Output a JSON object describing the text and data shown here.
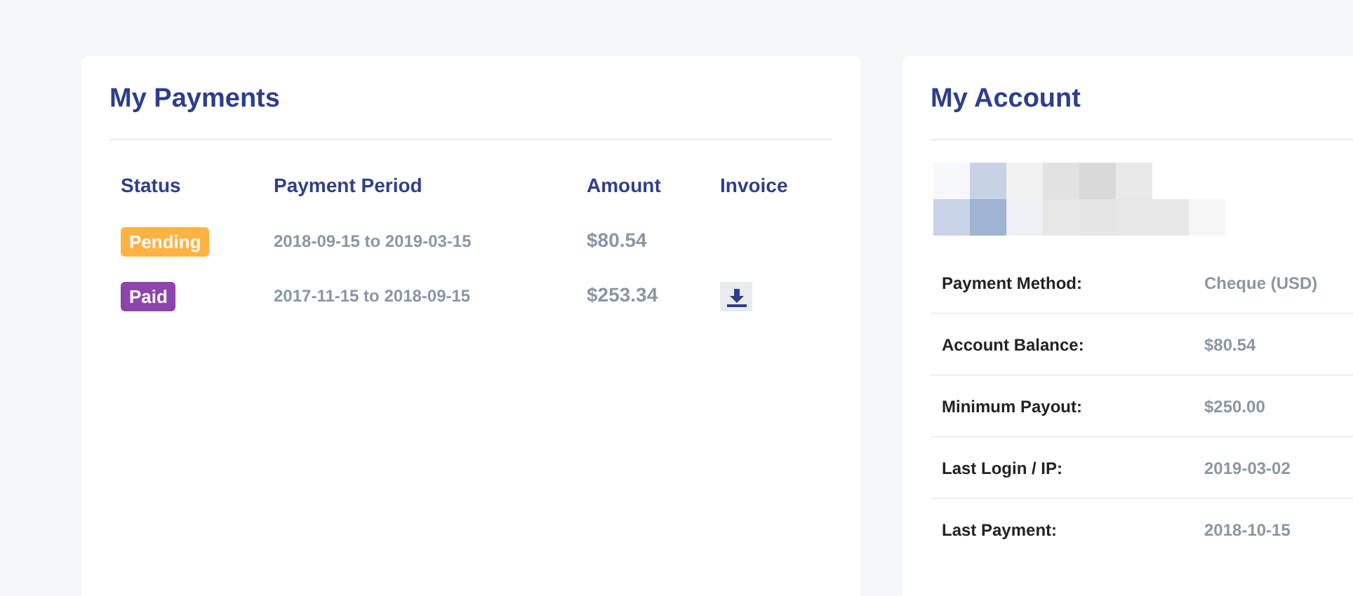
{
  "payments": {
    "title": "My Payments",
    "columns": [
      "Status",
      "Payment Period",
      "Amount",
      "Invoice"
    ],
    "rows": [
      {
        "status": "Pending",
        "color": "#ffb244",
        "period": "2018-09-15 to 2019-03-15",
        "amount": "$80.54",
        "has_invoice": false
      },
      {
        "status": "Paid",
        "color": "#8e44ad",
        "period": "2017-11-15 to 2018-09-15",
        "amount": "$253.34",
        "has_invoice": true
      }
    ]
  },
  "account": {
    "title": "My Account",
    "details": [
      {
        "label": "Payment Method:",
        "value": "Cheque (USD)"
      },
      {
        "label": "Account Balance:",
        "value": "$80.54"
      },
      {
        "label": "Minimum Payout:",
        "value": "$250.00"
      },
      {
        "label": "Last Login / IP:",
        "value": "2019-03-02"
      },
      {
        "label": "Last Payment:",
        "value": "2018-10-15"
      }
    ]
  }
}
